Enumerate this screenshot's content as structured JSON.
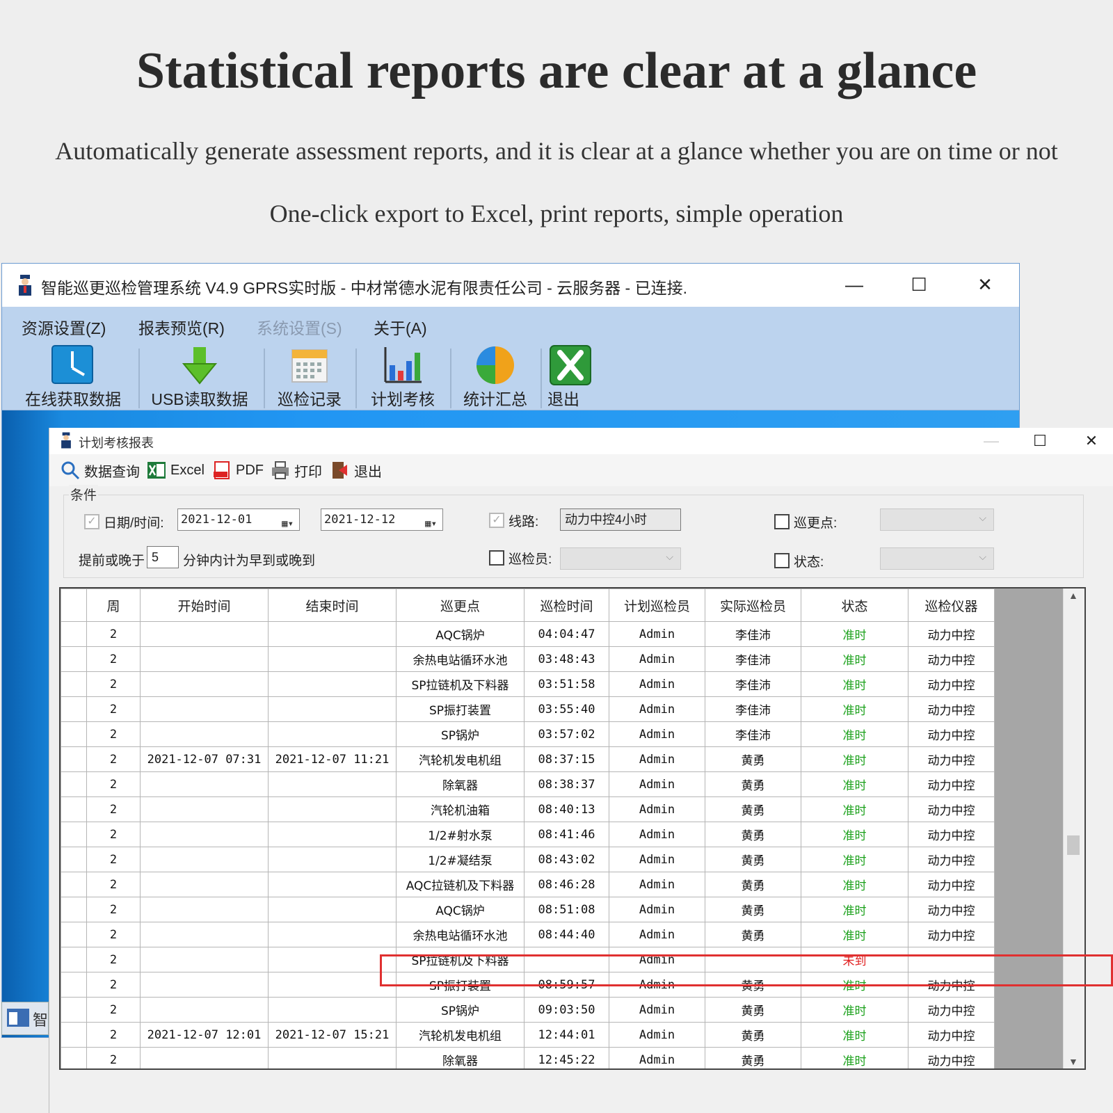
{
  "hero": {
    "title": "Statistical reports are clear at a glance",
    "line1": "Automatically generate assessment reports, and it is clear at a glance whether you are on time or not",
    "line2": "One-click export to Excel, print reports, simple operation"
  },
  "app": {
    "title": "智能巡更巡检管理系统 V4.9 GPRS实时版 - 中材常德水泥有限责任公司 - 云服务器 - 已连接.",
    "minimize": "—",
    "maximize": "☐",
    "close": "✕",
    "menu": [
      "资源设置(Z)",
      "报表预览(R)",
      "系统设置(S)",
      "关于(A)"
    ],
    "toolbar": [
      "在线获取数据",
      "USB读取数据",
      "巡检记录",
      "计划考核",
      "统计汇总",
      "退出"
    ],
    "taskbar_label": "智"
  },
  "report": {
    "title": "计划考核报表",
    "toolbar": [
      "数据查询",
      "Excel",
      "PDF",
      "打印",
      "退出"
    ],
    "conditions": {
      "legend": "条件",
      "date_label": "日期/时间:",
      "date_from": "2021-12-01",
      "date_to": "2021-12-12",
      "route_label": "线路:",
      "route_value": "动力中控4小时",
      "point_label": "巡更点:",
      "early_label": "提前或晚于",
      "early_value": "5",
      "early_suffix": "分钟内计为早到或晚到",
      "inspector_label": "巡检员:",
      "status_label": "状态:"
    },
    "columns": [
      "周",
      "开始时间",
      "结束时间",
      "巡更点",
      "巡检时间",
      "计划巡检员",
      "实际巡检员",
      "状态",
      "巡检仪器"
    ],
    "rows": [
      {
        "week": "2",
        "start": "",
        "end": "",
        "point": "AQC锅炉",
        "time": "04:04:47",
        "plan": "Admin",
        "actual": "李佳沛",
        "status": "准时",
        "device": "动力中控"
      },
      {
        "week": "2",
        "start": "",
        "end": "",
        "point": "余热电站循环水池",
        "time": "03:48:43",
        "plan": "Admin",
        "actual": "李佳沛",
        "status": "准时",
        "device": "动力中控"
      },
      {
        "week": "2",
        "start": "",
        "end": "",
        "point": "SP拉链机及下料器",
        "time": "03:51:58",
        "plan": "Admin",
        "actual": "李佳沛",
        "status": "准时",
        "device": "动力中控"
      },
      {
        "week": "2",
        "start": "",
        "end": "",
        "point": "SP振打装置",
        "time": "03:55:40",
        "plan": "Admin",
        "actual": "李佳沛",
        "status": "准时",
        "device": "动力中控"
      },
      {
        "week": "2",
        "start": "",
        "end": "",
        "point": "SP锅炉",
        "time": "03:57:02",
        "plan": "Admin",
        "actual": "李佳沛",
        "status": "准时",
        "device": "动力中控"
      },
      {
        "week": "2",
        "start": "2021-12-07 07:31",
        "end": "2021-12-07 11:21",
        "point": "汽轮机发电机组",
        "time": "08:37:15",
        "plan": "Admin",
        "actual": "黄勇",
        "status": "准时",
        "device": "动力中控"
      },
      {
        "week": "2",
        "start": "",
        "end": "",
        "point": "除氧器",
        "time": "08:38:37",
        "plan": "Admin",
        "actual": "黄勇",
        "status": "准时",
        "device": "动力中控"
      },
      {
        "week": "2",
        "start": "",
        "end": "",
        "point": "汽轮机油箱",
        "time": "08:40:13",
        "plan": "Admin",
        "actual": "黄勇",
        "status": "准时",
        "device": "动力中控"
      },
      {
        "week": "2",
        "start": "",
        "end": "",
        "point": "1/2#射水泵",
        "time": "08:41:46",
        "plan": "Admin",
        "actual": "黄勇",
        "status": "准时",
        "device": "动力中控"
      },
      {
        "week": "2",
        "start": "",
        "end": "",
        "point": "1/2#凝结泵",
        "time": "08:43:02",
        "plan": "Admin",
        "actual": "黄勇",
        "status": "准时",
        "device": "动力中控"
      },
      {
        "week": "2",
        "start": "",
        "end": "",
        "point": "AQC拉链机及下料器",
        "time": "08:46:28",
        "plan": "Admin",
        "actual": "黄勇",
        "status": "准时",
        "device": "动力中控"
      },
      {
        "week": "2",
        "start": "",
        "end": "",
        "point": "AQC锅炉",
        "time": "08:51:08",
        "plan": "Admin",
        "actual": "黄勇",
        "status": "准时",
        "device": "动力中控"
      },
      {
        "week": "2",
        "start": "",
        "end": "",
        "point": "余热电站循环水池",
        "time": "08:44:40",
        "plan": "Admin",
        "actual": "黄勇",
        "status": "准时",
        "device": "动力中控"
      },
      {
        "week": "2",
        "start": "",
        "end": "",
        "point": "SP拉链机及下料器",
        "time": "",
        "plan": "Admin",
        "actual": "",
        "status": "未到",
        "device": ""
      },
      {
        "week": "2",
        "start": "",
        "end": "",
        "point": "SP振打装置",
        "time": "08:59:57",
        "plan": "Admin",
        "actual": "黄勇",
        "status": "准时",
        "device": "动力中控"
      },
      {
        "week": "2",
        "start": "",
        "end": "",
        "point": "SP锅炉",
        "time": "09:03:50",
        "plan": "Admin",
        "actual": "黄勇",
        "status": "准时",
        "device": "动力中控"
      },
      {
        "week": "2",
        "start": "2021-12-07 12:01",
        "end": "2021-12-07 15:21",
        "point": "汽轮机发电机组",
        "time": "12:44:01",
        "plan": "Admin",
        "actual": "黄勇",
        "status": "准时",
        "device": "动力中控"
      },
      {
        "week": "2",
        "start": "",
        "end": "",
        "point": "除氧器",
        "time": "12:45:22",
        "plan": "Admin",
        "actual": "黄勇",
        "status": "准时",
        "device": "动力中控"
      }
    ]
  },
  "colors": {
    "ontime": "#19a019",
    "late": "#e02020",
    "highlight": "#e03030"
  }
}
